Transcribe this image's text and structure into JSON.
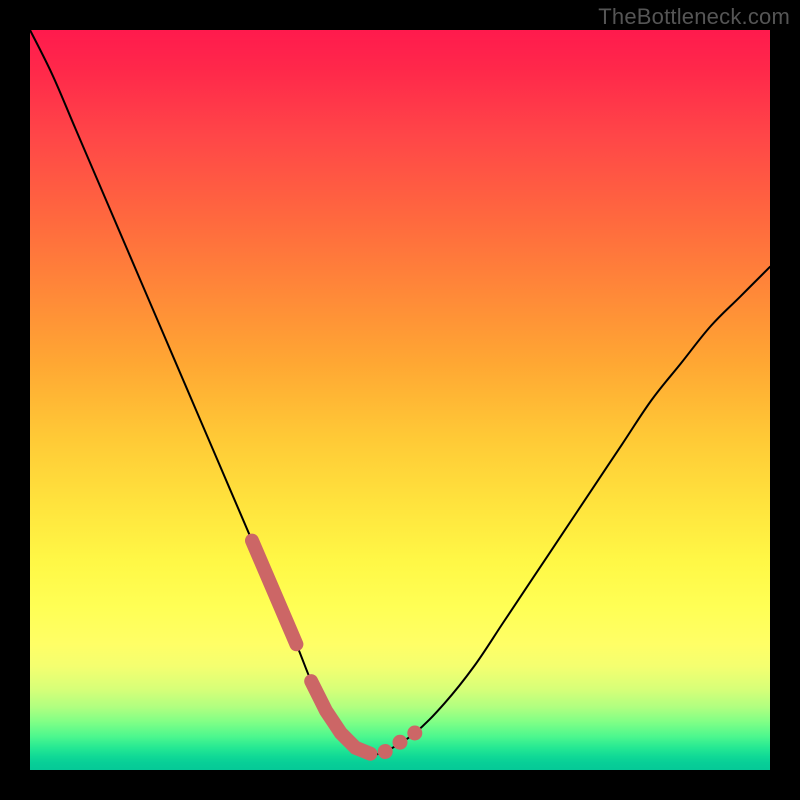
{
  "watermark": "TheBottleneck.com",
  "colors": {
    "marker": "#cc6666",
    "line": "#000000",
    "frame_bg": "#000000"
  },
  "chart_data": {
    "type": "line",
    "title": "",
    "xlabel": "",
    "ylabel": "",
    "xlim": [
      0,
      100
    ],
    "ylim": [
      0,
      100
    ],
    "grid": false,
    "series": [
      {
        "name": "bottleneck_curve",
        "x": [
          0,
          3,
          6,
          9,
          12,
          15,
          18,
          21,
          24,
          27,
          30,
          33,
          36,
          38,
          40,
          42,
          44,
          46,
          48,
          52,
          56,
          60,
          64,
          68,
          72,
          76,
          80,
          84,
          88,
          92,
          96,
          100
        ],
        "y": [
          100,
          94,
          87,
          80,
          73,
          66,
          59,
          52,
          45,
          38,
          31,
          24,
          17,
          12,
          8,
          5,
          3,
          2.2,
          2.5,
          5,
          9,
          14,
          20,
          26,
          32,
          38,
          44,
          50,
          55,
          60,
          64,
          68
        ]
      }
    ],
    "markers": {
      "left_cluster_x_range": [
        30,
        36
      ],
      "right_cluster_x": [
        48,
        50,
        52
      ],
      "flat_bottom_x_range": [
        38,
        46
      ]
    }
  }
}
